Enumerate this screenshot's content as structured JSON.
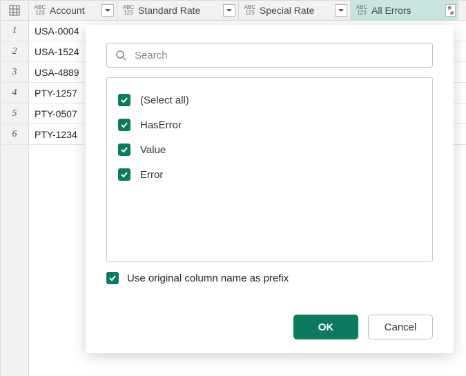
{
  "columns": [
    {
      "name": "Account"
    },
    {
      "name": "Standard Rate"
    },
    {
      "name": "Special Rate"
    },
    {
      "name": "All Errors"
    }
  ],
  "rows": [
    {
      "n": "1",
      "account": "USA-0004"
    },
    {
      "n": "2",
      "account": "USA-1524"
    },
    {
      "n": "3",
      "account": "USA-4889"
    },
    {
      "n": "4",
      "account": "PTY-1257"
    },
    {
      "n": "5",
      "account": "PTY-0507"
    },
    {
      "n": "6",
      "account": "PTY-1234"
    }
  ],
  "popup": {
    "search_placeholder": "Search",
    "options": {
      "select_all": "(Select all)",
      "o1": "HasError",
      "o2": "Value",
      "o3": "Error"
    },
    "prefix_label": "Use original column name as prefix",
    "ok_label": "OK",
    "cancel_label": "Cancel"
  }
}
